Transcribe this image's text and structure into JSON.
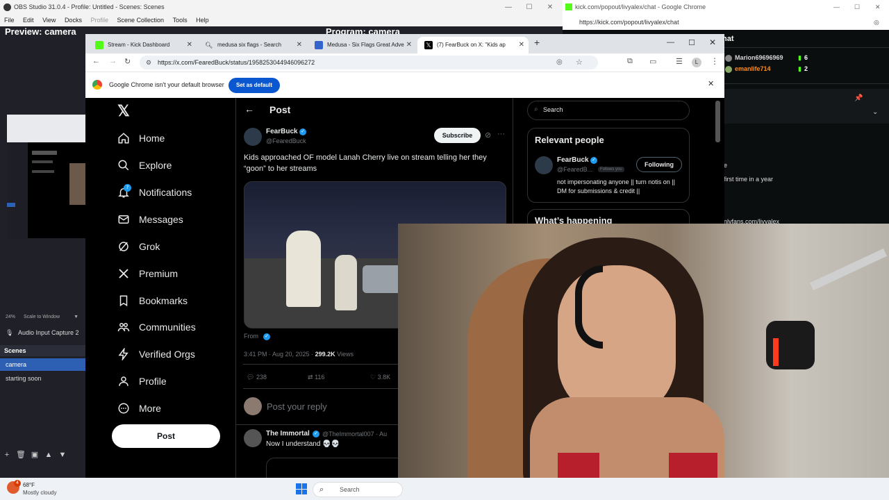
{
  "obs": {
    "title": "OBS Studio 31.0.4 - Profile: Untitled - Scenes: Scenes",
    "menu": [
      "File",
      "Edit",
      "View",
      "Docks",
      "Profile",
      "Scene Collection",
      "Tools",
      "Help"
    ],
    "preview_label": "Preview: camera",
    "program_label": "Program: camera",
    "zoom": "24%",
    "scale_mode": "Scale to Window",
    "audio_source": "Audio Input Capture 2",
    "scenes_header": "Scenes",
    "scenes": [
      "camera",
      "starting soon"
    ],
    "active_scene": "camera"
  },
  "taskbar": {
    "weather_temp": "68°F",
    "weather_desc": "Mostly cloudy",
    "weather_badge": "4",
    "search_placeholder": "Search"
  },
  "kick": {
    "title": "kick.com/popout/livyalex/chat - Google Chrome",
    "url": "https://kick.com/popout/livyalex/chat",
    "header_fragment": "hat",
    "users": [
      {
        "name": "Marion69696969",
        "count": "6",
        "color": "#d6d6d6"
      },
      {
        "name": "emanlife714",
        "count": "2",
        "color": "#ff8c1a"
      }
    ],
    "msg_fragment_1": "e",
    "msg_fragment_2": "first time in a year",
    "msg_fragment_3": "nlyfans.com/livyalex"
  },
  "chrome": {
    "tabs": [
      {
        "title": "Stream - Kick Dashboard",
        "color": "#53fc18"
      },
      {
        "title": "medusa six flags - Search",
        "color": "#888888"
      },
      {
        "title": "Medusa - Six Flags Great Adve",
        "color": "#3366cc"
      },
      {
        "title": "(7) FearBuck on X: \"Kids ap",
        "color": "#000000"
      }
    ],
    "new_tab": "+",
    "url": "https://x.com/FearedBuck/status/1958253044946096272",
    "profile_initial": "L",
    "infobar_text": "Google Chrome isn't your default browser",
    "infobar_button": "Set as default"
  },
  "x": {
    "nav": [
      {
        "label": "Home",
        "icon": "home-icon"
      },
      {
        "label": "Explore",
        "icon": "search-icon"
      },
      {
        "label": "Notifications",
        "icon": "bell-icon"
      },
      {
        "label": "Messages",
        "icon": "mail-icon"
      },
      {
        "label": "Grok",
        "icon": "grok-icon"
      },
      {
        "label": "Premium",
        "icon": "x-logo-icon"
      },
      {
        "label": "Bookmarks",
        "icon": "bookmark-icon"
      },
      {
        "label": "Communities",
        "icon": "communities-icon"
      },
      {
        "label": "Verified Orgs",
        "icon": "lightning-icon"
      },
      {
        "label": "Profile",
        "icon": "person-icon"
      },
      {
        "label": "More",
        "icon": "more-icon"
      }
    ],
    "notif_badge": "7",
    "post_button": "Post",
    "header_title": "Post",
    "post": {
      "author": "FearBuck",
      "handle": "@FearedBuck",
      "subscribe": "Subscribe",
      "text": "Kids approached OF model Lanah Cherry live on stream telling her they “goon” to her streams",
      "from_label": "From",
      "time": "3:41 PM · Aug 20, 2025 · ",
      "views": "299.2K",
      "views_label": " Views",
      "replies": "238",
      "reposts": "116",
      "likes": "3.8K"
    },
    "reply_placeholder": "Post your reply",
    "reply": {
      "author": "The Immortal",
      "handle": "@TheImmortal007 · Au",
      "text": "Now I understand 💀💀"
    },
    "search_placeholder": "Search",
    "relevant_title": "Relevant people",
    "relevant": {
      "name": "FearBuck",
      "handle": "@FearedB...",
      "follows_you": "Follows you",
      "button": "Following",
      "bio": "not impersonating anyone || turn notis on || DM for submissions & credit ||"
    },
    "happening_title": "What’s happening"
  }
}
